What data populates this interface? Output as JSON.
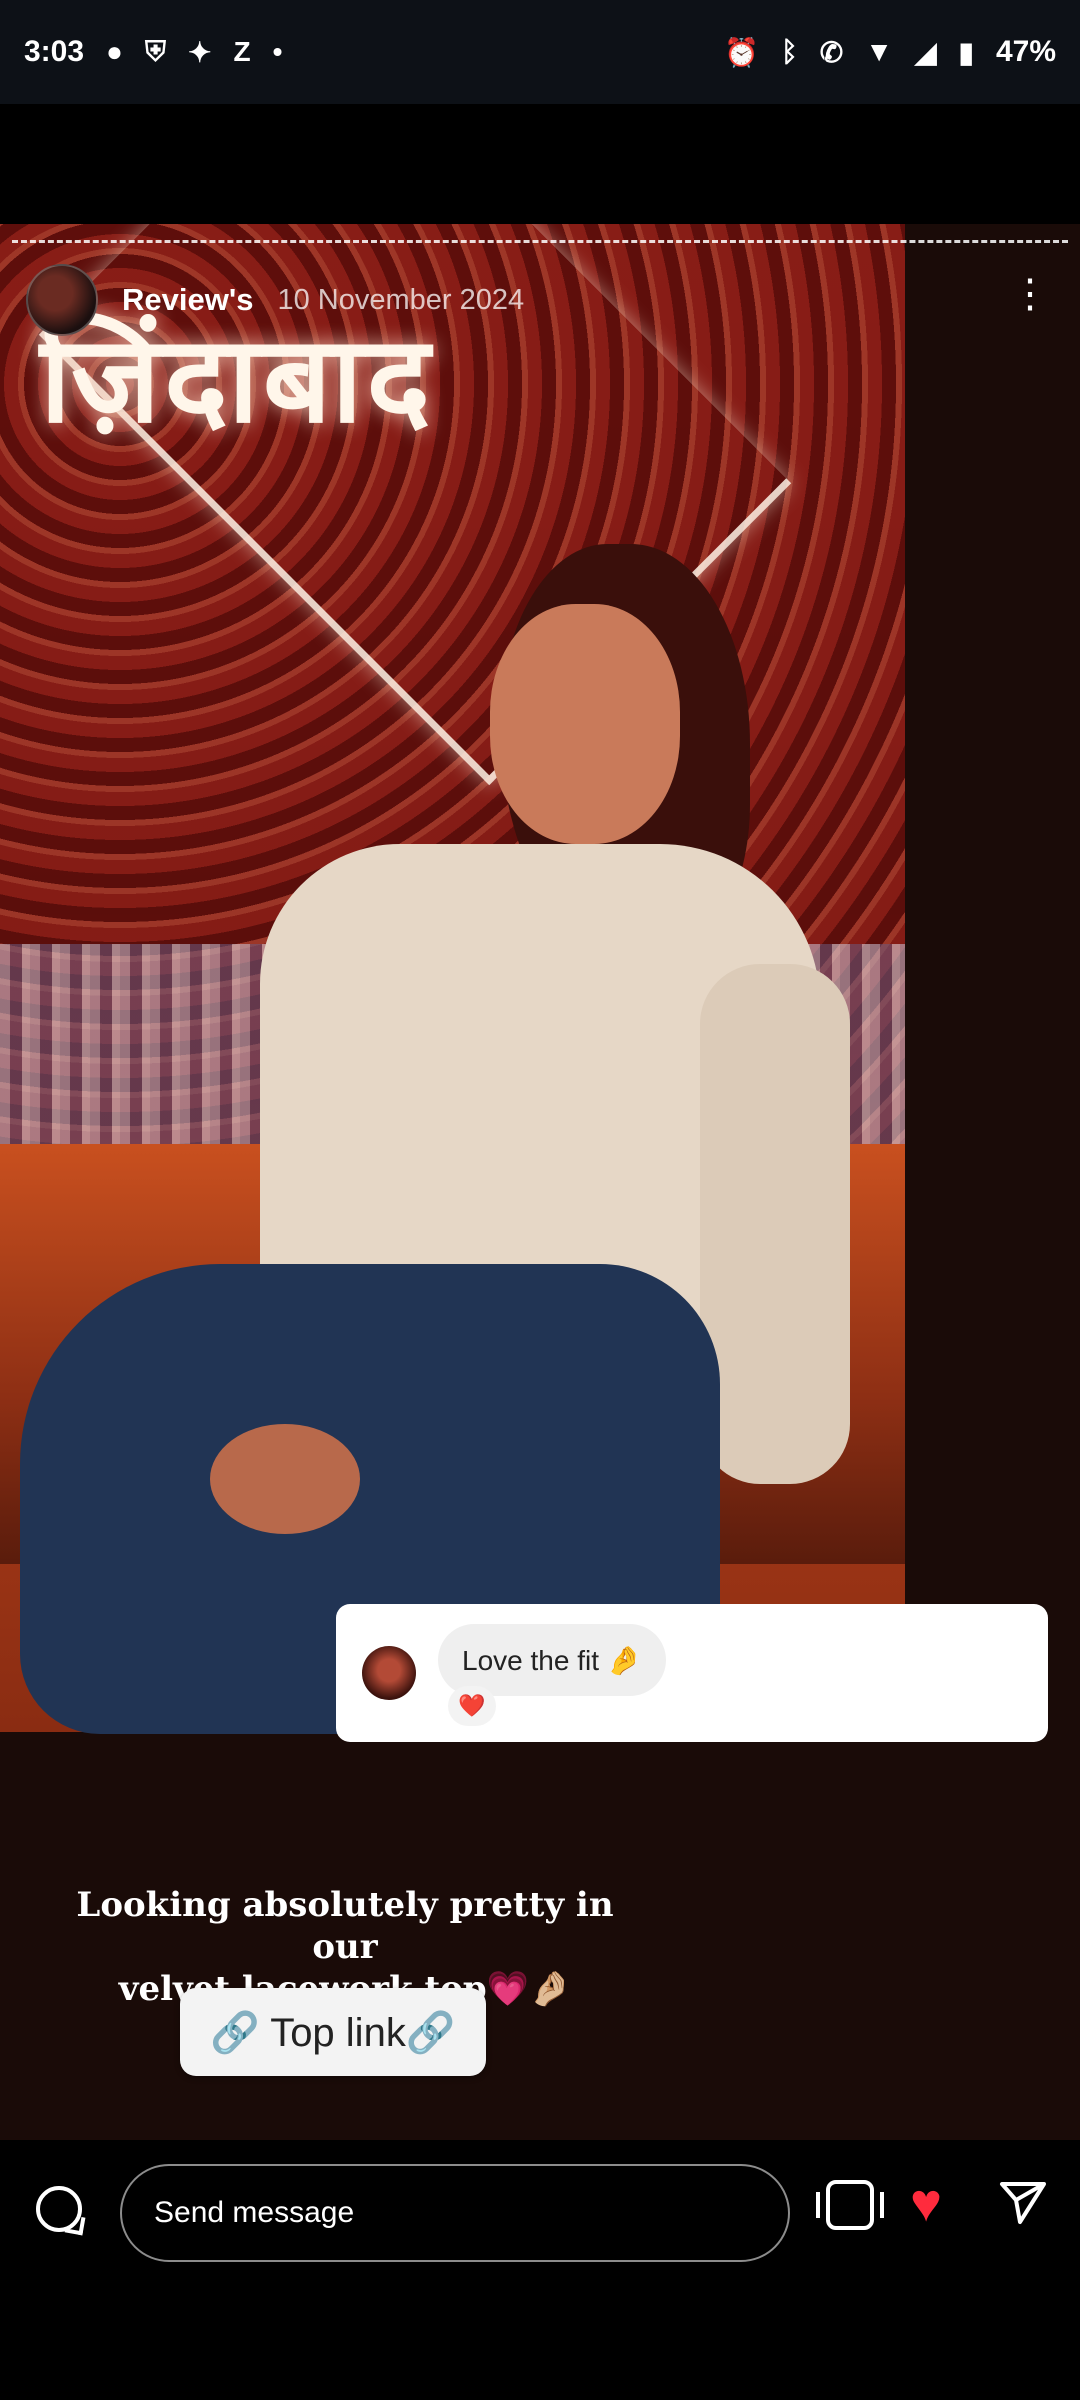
{
  "status_bar": {
    "time": "3:03",
    "left_icons": [
      "chat-bubble-icon",
      "shield-icon",
      "app-icon",
      "z-icon",
      "dot-icon"
    ],
    "right_icons": [
      "alarm-icon",
      "bluetooth-icon",
      "wifi-call-icon",
      "wifi-icon",
      "signal-icon",
      "battery-icon"
    ],
    "battery": "47%"
  },
  "story": {
    "username": "Review's",
    "date": "10 November 2024",
    "more_icon": "more-vertical-icon",
    "photo_neon_text": "ज़िंदाबाद"
  },
  "comment": {
    "text": "Love the fit 🤌",
    "reaction": "❤️"
  },
  "caption": {
    "line1": "Looking absolutely pretty in our",
    "line2": "velvet lacework top💗🤌🏼"
  },
  "link_sticker": {
    "label": "Top link🔗",
    "icon": "link-icon"
  },
  "bottom_bar": {
    "message_placeholder": "Send message",
    "comment_icon": "comment-icon",
    "device_icon": "device-icon",
    "like_icon": "heart-icon",
    "send_icon": "send-icon",
    "like_color": "#ff2b3d"
  }
}
